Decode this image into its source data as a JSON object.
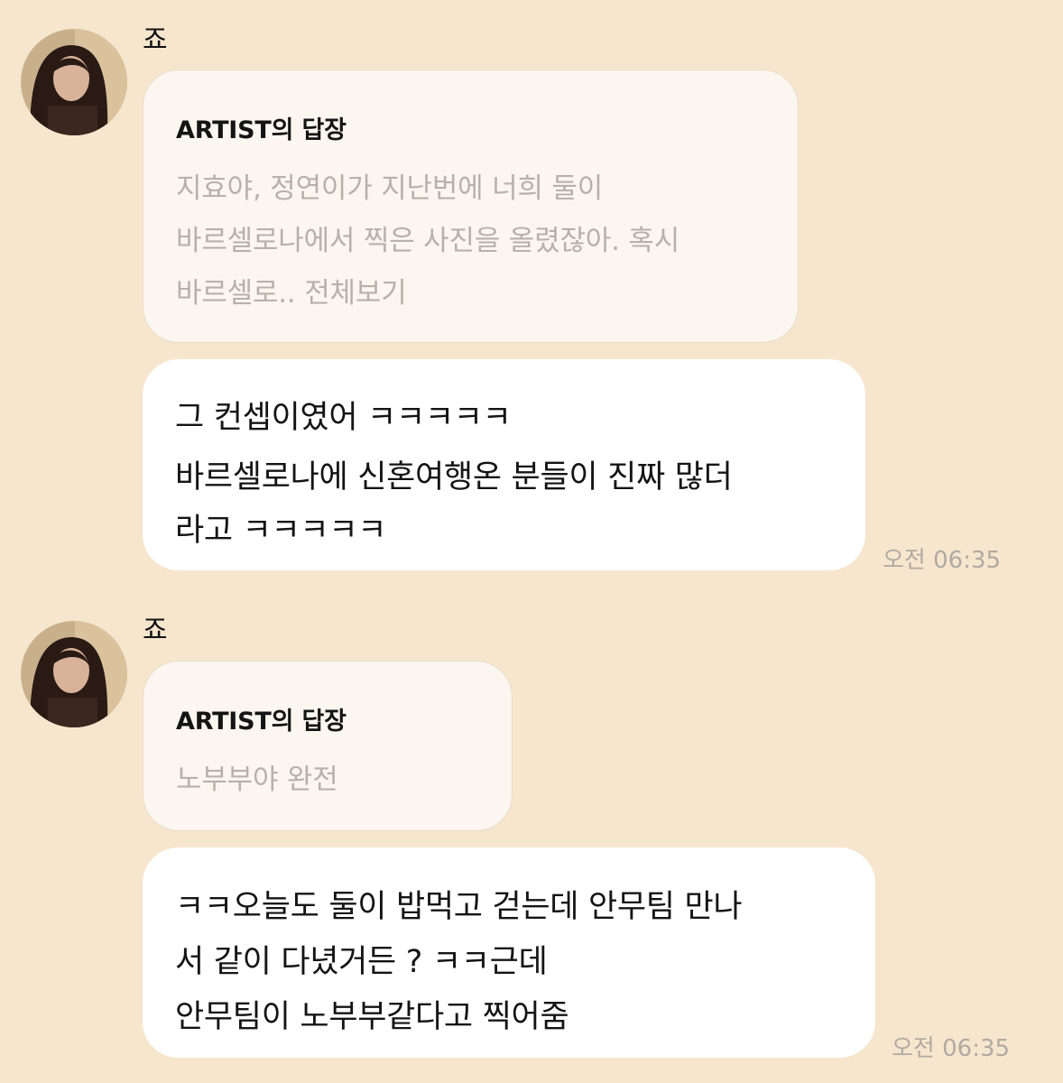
{
  "messages": [
    {
      "sender": "죠",
      "reply": {
        "title": "ARTIST의 답장",
        "lines": [
          "지효야, 정연이가 지난번에 너희 둘이",
          "바르셀로나에서 찍은 사진을 올렸잖아. 혹시",
          "바르셀로.. 전체보기"
        ]
      },
      "body": [
        "그 컨셉이였어 ㅋㅋㅋㅋㅋ",
        "바르셀로나에 신혼여행온 분들이 진짜 많더",
        "라고 ㅋㅋㅋㅋㅋ"
      ],
      "time": "오전 06:35"
    },
    {
      "sender": "죠",
      "reply": {
        "title": "ARTIST의 답장",
        "lines": [
          "노부부야 완전"
        ]
      },
      "body": [
        "ㅋㅋ오늘도 둘이 밥먹고 걷는데 안무팀 만나",
        "서 같이 다녔거든 ? ㅋㅋ근데",
        "안무팀이 노부부같다고 찍어줌"
      ],
      "time": "오전 06:35"
    }
  ]
}
